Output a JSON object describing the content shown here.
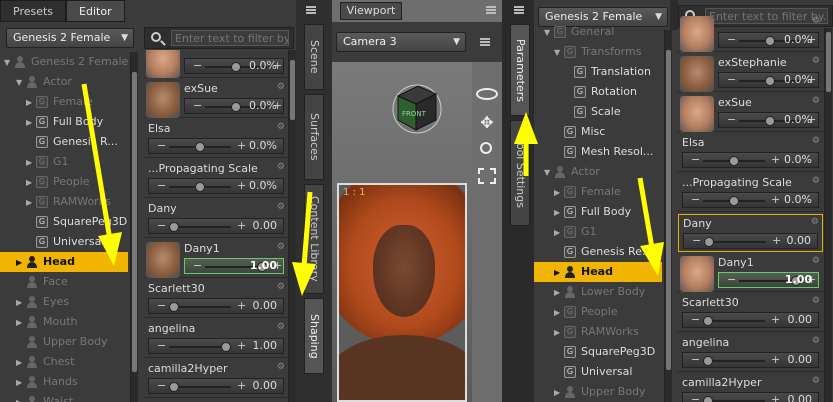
{
  "left": {
    "tabs": [
      "Presets",
      "Editor"
    ],
    "dropdown": "Genesis 2 Female",
    "search_placeholder": "Enter text to filter by...",
    "tree": [
      {
        "label": "Genesis 2 Female",
        "icon": "figure",
        "arrow": "▼",
        "dim": true
      },
      {
        "label": "Actor",
        "icon": "figure",
        "arrow": "▼",
        "dim": true
      },
      {
        "label": "Female",
        "icon": "G",
        "arrow": "▶",
        "dim": true
      },
      {
        "label": "Full Body",
        "icon": "G",
        "arrow": "▶",
        "dim": false
      },
      {
        "label": "Genesis R...",
        "icon": "G",
        "arrow": "",
        "dim": false
      },
      {
        "label": "G1",
        "icon": "G",
        "arrow": "▶",
        "dim": true
      },
      {
        "label": "People",
        "icon": "G",
        "arrow": "▶",
        "dim": true
      },
      {
        "label": "RAMWorks",
        "icon": "G",
        "arrow": "▶",
        "dim": true
      },
      {
        "label": "SquarePeg3D",
        "icon": "G",
        "arrow": "",
        "dim": false
      },
      {
        "label": "Universal",
        "icon": "G",
        "arrow": "",
        "dim": false
      },
      {
        "label": "Head",
        "icon": "figure",
        "arrow": "▶",
        "selected": true
      },
      {
        "label": "Face",
        "icon": "figure",
        "arrow": "",
        "dim": true
      },
      {
        "label": "Eyes",
        "icon": "figure",
        "arrow": "▶",
        "dim": true
      },
      {
        "label": "Mouth",
        "icon": "figure",
        "arrow": "▶",
        "dim": true
      },
      {
        "label": "Upper Body",
        "icon": "figure",
        "arrow": "",
        "dim": true
      },
      {
        "label": "Chest",
        "icon": "figure",
        "arrow": "▶",
        "dim": true
      },
      {
        "label": "Hands",
        "icon": "figure",
        "arrow": "▶",
        "dim": true
      },
      {
        "label": "Waist",
        "icon": "figure",
        "arrow": "▶",
        "dim": true
      }
    ],
    "props": [
      {
        "name": "",
        "value": "0.0%",
        "thumb": true,
        "knob": 0.5
      },
      {
        "name": "exSue",
        "value": "0.0%",
        "thumb": true,
        "knob": 0.5
      },
      {
        "name": "Elsa",
        "value": "0.0%",
        "knob": 0.5
      },
      {
        "name": "...Propagating Scale",
        "value": "0.0%",
        "knob": 0.5
      },
      {
        "name": "Dany",
        "value": "0.00",
        "knob": 0.0
      },
      {
        "name": "Dany1",
        "value": "1.00",
        "thumb": true,
        "knob": 1.0,
        "highlight": true
      },
      {
        "name": "Scarlett30",
        "value": "0.00",
        "knob": 0.0
      },
      {
        "name": "angelina",
        "value": "1.00",
        "knob": 1.0
      },
      {
        "name": "camilla2Hyper",
        "value": "0.00",
        "knob": 0.0
      }
    ],
    "side_tabs": [
      "Scene",
      "Surfaces",
      "Content Library",
      "Shaping"
    ]
  },
  "viewport": {
    "tab": "Viewport",
    "camera": "Camera 3",
    "aspect_label": "1 : 1",
    "cube_label": "FRONT"
  },
  "right": {
    "side_tabs": [
      "Parameters",
      "Tool Settings"
    ],
    "dropdown": "Genesis 2 Female",
    "search_placeholder": "Enter text to filter by...",
    "tree": [
      {
        "label": "General",
        "icon": "G",
        "arrow": "▼",
        "dim": true
      },
      {
        "label": "Transforms",
        "icon": "G",
        "arrow": "▼",
        "dim": true
      },
      {
        "label": "Translation",
        "icon": "G",
        "arrow": "",
        "dim": false
      },
      {
        "label": "Rotation",
        "icon": "G",
        "arrow": "",
        "dim": false
      },
      {
        "label": "Scale",
        "icon": "G",
        "arrow": "",
        "dim": false
      },
      {
        "label": "Misc",
        "icon": "G",
        "arrow": "",
        "dim": false
      },
      {
        "label": "Mesh Resol...",
        "icon": "G",
        "arrow": "",
        "dim": false
      },
      {
        "label": "Actor",
        "icon": "figure",
        "arrow": "▼",
        "dim": true
      },
      {
        "label": "Female",
        "icon": "G",
        "arrow": "▶",
        "dim": true
      },
      {
        "label": "Full Body",
        "icon": "G",
        "arrow": "▶",
        "dim": false
      },
      {
        "label": "G1",
        "icon": "G",
        "arrow": "▶",
        "dim": true
      },
      {
        "label": "Genesis Re...",
        "icon": "G",
        "arrow": "",
        "dim": false
      },
      {
        "label": "Head",
        "icon": "figure",
        "arrow": "▶",
        "selected": true
      },
      {
        "label": "Lower Body",
        "icon": "figure",
        "arrow": "▶",
        "dim": true
      },
      {
        "label": "People",
        "icon": "G",
        "arrow": "▶",
        "dim": true
      },
      {
        "label": "RAMWorks",
        "icon": "G",
        "arrow": "▶",
        "dim": true
      },
      {
        "label": "SquarePeg3D",
        "icon": "G",
        "arrow": "",
        "dim": false
      },
      {
        "label": "Universal",
        "icon": "G",
        "arrow": "",
        "dim": false
      },
      {
        "label": "Upper Body",
        "icon": "figure",
        "arrow": "▶",
        "dim": true
      }
    ],
    "props": [
      {
        "name": "",
        "value": "0.0%",
        "thumb": true,
        "knob": 0.5
      },
      {
        "name": "exStephanie",
        "value": "0.0%",
        "thumb": true,
        "knob": 0.5
      },
      {
        "name": "exSue",
        "value": "0.0%",
        "thumb": true,
        "knob": 0.5
      },
      {
        "name": "Elsa",
        "value": "0.0%",
        "knob": 0.5
      },
      {
        "name": "...Propagating Scale",
        "value": "0.0%",
        "knob": 0.5
      },
      {
        "name": "Dany",
        "value": "0.00",
        "knob": 0.0,
        "boxed": true
      },
      {
        "name": "Dany1",
        "value": "1.00",
        "thumb": true,
        "knob": 1.0,
        "highlight": true
      },
      {
        "name": "Scarlett30",
        "value": "0.00",
        "knob": 0.0
      },
      {
        "name": "angelina",
        "value": "0.00",
        "knob": 0.0
      },
      {
        "name": "camilla2Hyper",
        "value": "0.00",
        "knob": 0.0
      }
    ]
  },
  "colors": {
    "selection": "#f1b400",
    "annotation_arrow": "#ffff00",
    "highlight_slider": "#66cc66"
  }
}
